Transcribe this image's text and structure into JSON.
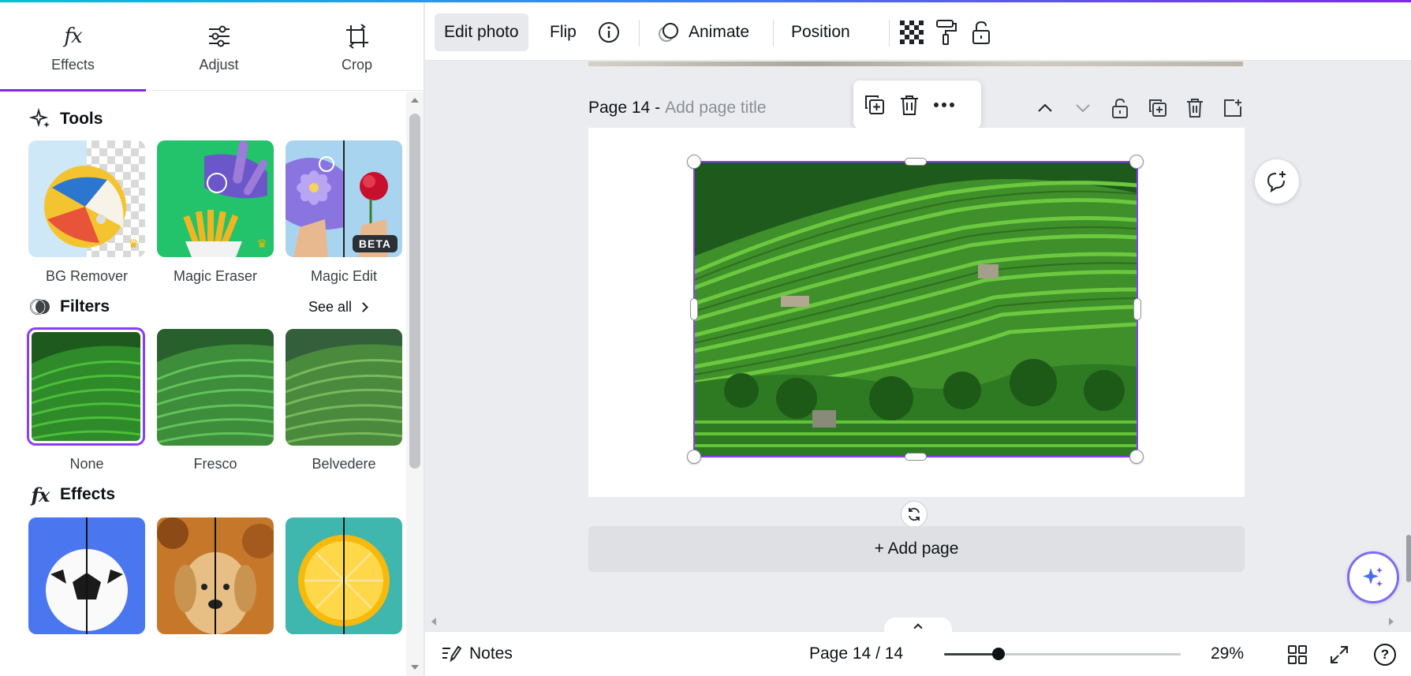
{
  "tabs": [
    {
      "label": "Effects",
      "icon": "fx-icon",
      "active": true
    },
    {
      "label": "Adjust",
      "icon": "sliders-icon"
    },
    {
      "label": "Crop",
      "icon": "crop-icon"
    }
  ],
  "tools": {
    "heading": "Tools",
    "items": [
      {
        "label": "BG Remover",
        "badge": "crown"
      },
      {
        "label": "Magic Eraser",
        "badge": "crown"
      },
      {
        "label": "Magic Edit",
        "badge": "BETA"
      }
    ]
  },
  "filters": {
    "heading": "Filters",
    "see_all": "See all",
    "selected": "None",
    "items": [
      {
        "label": "None"
      },
      {
        "label": "Fresco"
      },
      {
        "label": "Belvedere"
      }
    ]
  },
  "effects": {
    "heading": "Effects"
  },
  "toolbar": {
    "edit_photo": "Edit photo",
    "flip": "Flip",
    "animate": "Animate",
    "position": "Position"
  },
  "canvas": {
    "page_number": "Page 14 -",
    "page_title_placeholder": "Add page title",
    "add_page": "+ Add page"
  },
  "bottom": {
    "notes": "Notes",
    "page_indicator": "Page 14 / 14",
    "zoom": "29%",
    "zoom_fraction": 0.23,
    "help": "?"
  },
  "colors": {
    "accent": "#8b3dff",
    "selection": "#8b3dff"
  }
}
